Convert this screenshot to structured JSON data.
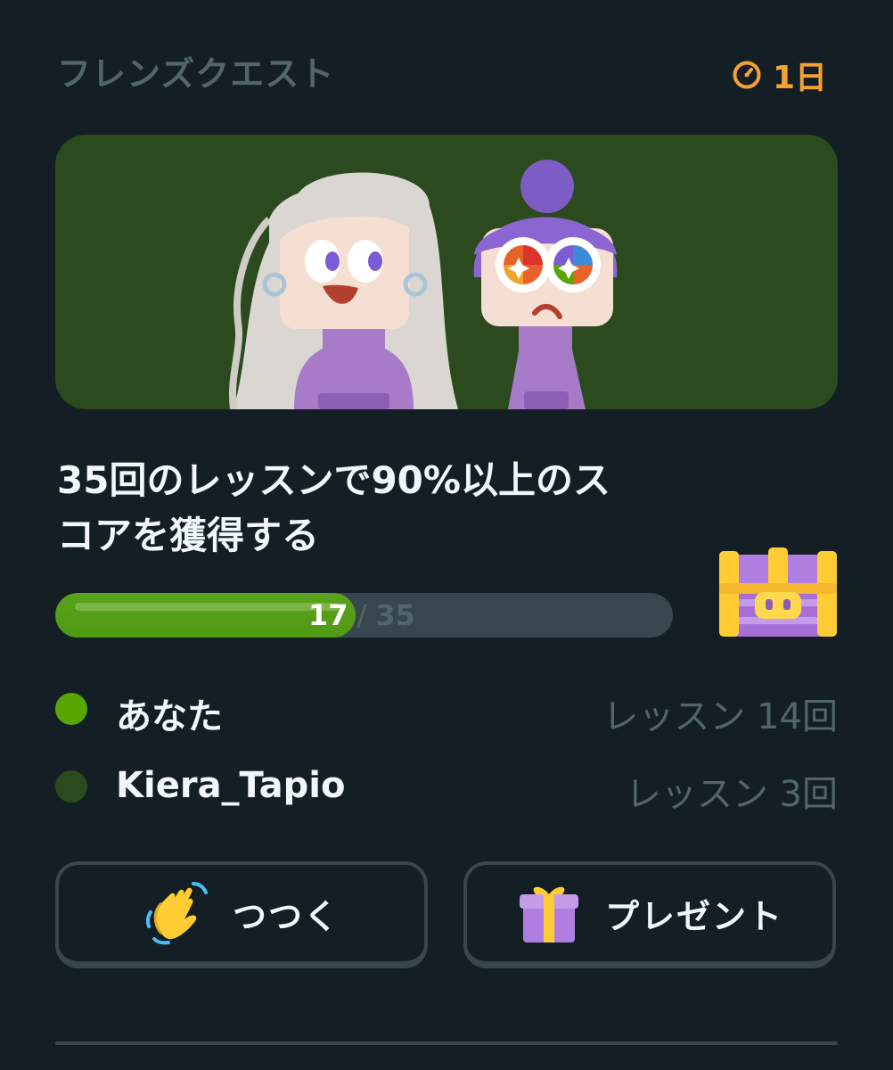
{
  "header": {
    "title": "フレンズクエスト",
    "timer_icon": "timer-icon",
    "timer_text": "1日"
  },
  "banner": {
    "illustration": "two-friends-illustration"
  },
  "quest": {
    "description_line1": "35回のレッスンで90%以上のス",
    "description_line2": "コアを獲得する",
    "progress": {
      "current": "17",
      "separator": "/",
      "total": "35",
      "fraction": 0.4857
    },
    "reward_icon": "treasure-chest-icon"
  },
  "members": [
    {
      "name": "あなた",
      "count_text": "レッスン 14回",
      "color": "#58a700"
    },
    {
      "name": "Kiera_Tapio",
      "count_text": "レッスン 3回",
      "color": "#2b4a1d"
    }
  ],
  "buttons": {
    "nudge": {
      "label": "つつく",
      "icon": "waving-hand-icon"
    },
    "gift": {
      "label": "プレゼント",
      "icon": "gift-icon"
    }
  },
  "colors": {
    "background": "#131f24",
    "accent_green": "#58a700",
    "banner_green": "#2b4a1d",
    "timer_orange": "#f6a230",
    "muted_text": "#52656d",
    "border": "#37464f"
  }
}
